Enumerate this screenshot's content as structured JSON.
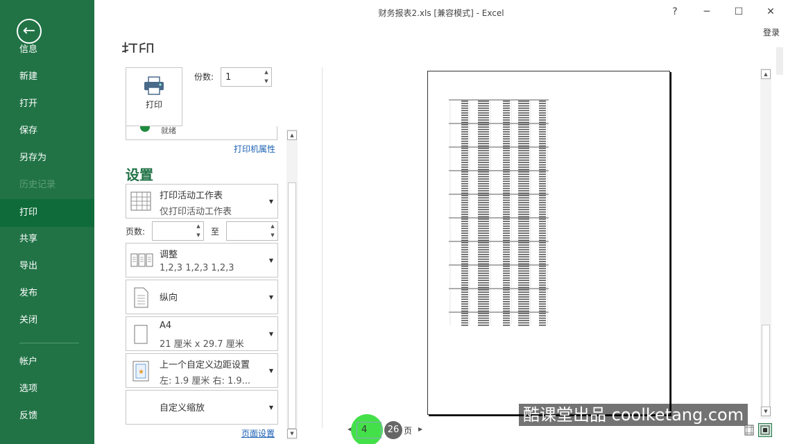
{
  "window": {
    "title": "财务报表2.xls  [兼容模式] - Excel",
    "help": "?",
    "minimize": "─",
    "maximize": "☐",
    "close": "✕",
    "login": "登录"
  },
  "sidebar": {
    "back_icon": "←",
    "items": [
      {
        "label": "信息"
      },
      {
        "label": "新建"
      },
      {
        "label": "打开"
      },
      {
        "label": "保存"
      },
      {
        "label": "另存为"
      },
      {
        "label": "历史记录"
      },
      {
        "label": "打印"
      },
      {
        "label": "共享"
      },
      {
        "label": "导出"
      },
      {
        "label": "发布"
      },
      {
        "label": "关闭"
      },
      {
        "label": "帐户"
      },
      {
        "label": "选项"
      },
      {
        "label": "反馈"
      }
    ]
  },
  "print": {
    "heading": "打印",
    "button_label": "打印",
    "copies_label": "份数:",
    "copies_value": "1",
    "printer_status": "就绪",
    "printer_properties": "打印机属性",
    "settings_heading": "设置",
    "what_to_print": {
      "title": "打印活动工作表",
      "subtitle": "仅打印活动工作表"
    },
    "pages_label": "页数:",
    "pages_to": "至",
    "collate": {
      "title": "调整",
      "subtitle": "1,2,3    1,2,3    1,2,3"
    },
    "orientation": {
      "title": "纵向"
    },
    "paper": {
      "title": "A4",
      "subtitle": "21 厘米 x 29.7 厘米"
    },
    "margins": {
      "title": "上一个自定义边距设置",
      "subtitle": "左:  1.9 厘米     右:  1.9..."
    },
    "scaling": {
      "title": "自定义缩放"
    },
    "page_setup": "页面设置"
  },
  "preview": {
    "current_page": "4",
    "total_pages": "26",
    "page_unit": "页"
  },
  "watermark": "酷课堂出品 coolketang.com",
  "colors": {
    "accent": "#217346",
    "link": "#1a5fb4",
    "highlight": "#44e04a"
  }
}
